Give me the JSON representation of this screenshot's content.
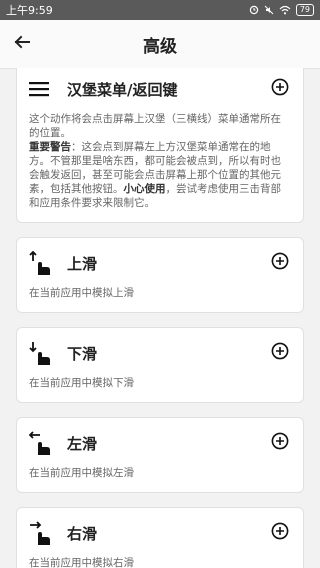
{
  "status": {
    "time": "上午9:59",
    "battery": "79"
  },
  "header": {
    "title": "高级"
  },
  "cards": [
    {
      "title": "汉堡菜单/返回键",
      "desc_intro": "这个动作将会点击屏幕上汉堡（三横线）菜单通常所在的位置。",
      "desc_warning_label": "重要警告",
      "desc_warning": "：这会点到屏幕左上方汉堡菜单通常在的地方。不管那里是啥东西，都可能会被点到，所以有时也会触发返回，甚至可能会点击屏幕上那个位置的其他元素，包括其他按钮。",
      "desc_caution_label": "小心使用",
      "desc_caution": "，尝试考虑使用三击背部和应用条件要求来限制它。"
    },
    {
      "title": "上滑",
      "desc": "在当前应用中模拟上滑"
    },
    {
      "title": "下滑",
      "desc": "在当前应用中模拟下滑"
    },
    {
      "title": "左滑",
      "desc": "在当前应用中模拟左滑"
    },
    {
      "title": "右滑",
      "desc": "在当前应用中模拟右滑"
    }
  ],
  "icons": {
    "back": "arrow-back-icon",
    "hamburger": "hamburger-menu-icon",
    "add": "add-circle-icon",
    "swipe_up": "swipe-up-icon",
    "swipe_down": "swipe-down-icon",
    "swipe_left": "swipe-left-icon",
    "swipe_right": "swipe-right-icon"
  }
}
